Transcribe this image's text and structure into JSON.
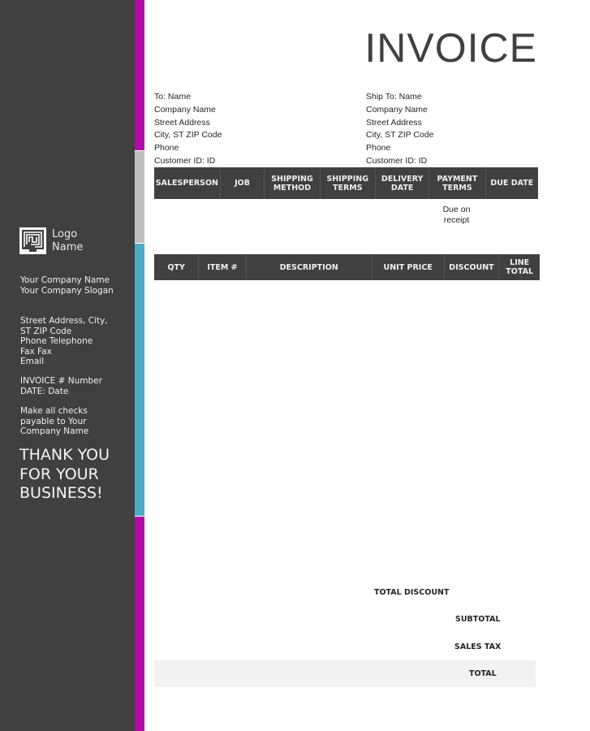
{
  "document_title": "INVOICE",
  "sidebar": {
    "logo_line1": "Logo",
    "logo_line2": "Name",
    "company_name": "Your Company Name",
    "company_slogan": "Your Company Slogan",
    "address_line1": "Street Address, City,",
    "address_line2": "ST  ZIP Code",
    "phone": "Phone Telephone",
    "fax": "Fax Fax",
    "email": "Email",
    "invoice_number": "INVOICE # Number",
    "date": "DATE: Date",
    "checks_line1": "Make all checks",
    "checks_line2": "payable to Your",
    "checks_line3": "Company Name",
    "thanks_line1": "THANK YOU",
    "thanks_line2": "FOR YOUR",
    "thanks_line3": "BUSINESS!"
  },
  "colors": {
    "sidebar": "#404040",
    "accent_magenta": "#b40aa8",
    "accent_gray": "#bfbfbf",
    "accent_teal": "#4aacc5",
    "header_fill": "#404040",
    "total_fill": "#f2f2f2"
  },
  "bill_to": {
    "name": "To: Name",
    "company": "Company Name",
    "street": "Street Address",
    "city": "City, ST  ZIP Code",
    "phone": "Phone",
    "customer_id": "Customer ID: ID"
  },
  "ship_to": {
    "name": "Ship To: Name",
    "company": "Company Name",
    "street": "Street Address",
    "city": "City, ST  ZIP Code",
    "phone": "Phone",
    "customer_id": "Customer ID: ID"
  },
  "order_table": {
    "headers": [
      "SALESPERSON",
      "JOB",
      "SHIPPING METHOD",
      "SHIPPING TERMS",
      "DELIVERY DATE",
      "PAYMENT TERMS",
      "DUE DATE"
    ],
    "header_lines": [
      [
        "SALESPERSON"
      ],
      [
        "JOB"
      ],
      [
        "SHIPPING",
        "METHOD"
      ],
      [
        "SHIPPING",
        "TERMS"
      ],
      [
        "DELIVERY",
        "DATE"
      ],
      [
        "PAYMENT",
        "TERMS"
      ],
      [
        "DUE DATE"
      ]
    ],
    "row": [
      "",
      "",
      "",
      "",
      "",
      "Due on receipt",
      ""
    ],
    "payment_terms_line1": "Due on",
    "payment_terms_line2": "receipt"
  },
  "items_table": {
    "headers": [
      "QTY",
      "ITEM #",
      "DESCRIPTION",
      "UNIT PRICE",
      "DISCOUNT",
      "LINE TOTAL"
    ],
    "line_total_line1": "LINE",
    "line_total_line2": "TOTAL",
    "rows": []
  },
  "totals": {
    "total_discount": "TOTAL DISCOUNT",
    "subtotal": "SUBTOTAL",
    "sales_tax": "SALES TAX",
    "total": "TOTAL"
  }
}
